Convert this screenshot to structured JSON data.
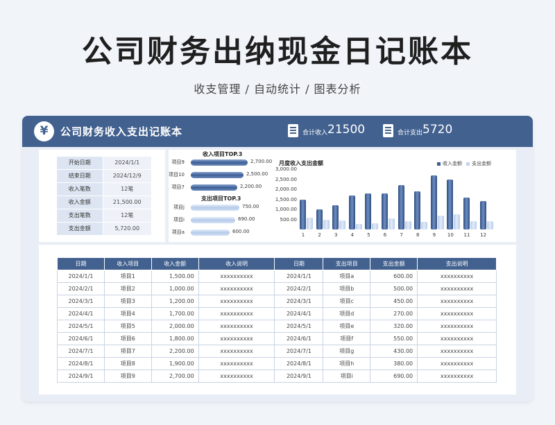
{
  "page": {
    "title": "公司财务出纳现金日记账本",
    "subtitle": "收支管理 / 自动统计 / 图表分析"
  },
  "header": {
    "icon": "yen-icon",
    "icon_glyph": "¥",
    "title": "公司财务收入支出记账本",
    "total_income_label": "合计收入",
    "total_income_value": "21500",
    "total_expense_label": "合计支出",
    "total_expense_value": "5720"
  },
  "summary": [
    {
      "label": "开始日期",
      "value": "2024/1/1"
    },
    {
      "label": "结束日期",
      "value": "2024/12/9"
    },
    {
      "label": "收入笔数",
      "value": "12笔"
    },
    {
      "label": "收入金额",
      "value": "21,500.00"
    },
    {
      "label": "支出笔数",
      "value": "12笔"
    },
    {
      "label": "支出金额",
      "value": "5,720.00"
    }
  ],
  "top3": {
    "income_title": "收入项目TOP.3",
    "income": [
      {
        "name": "项目9",
        "value": 2700,
        "label": "2,700.00"
      },
      {
        "name": "项目10",
        "value": 2500,
        "label": "2,500.00"
      },
      {
        "name": "项目7",
        "value": 2200,
        "label": "2,200.00"
      }
    ],
    "expense_title": "支出项目TOP.3",
    "expense": [
      {
        "name": "项目j",
        "value": 750,
        "label": "750.00"
      },
      {
        "name": "项目i",
        "value": 690,
        "label": "690.00"
      },
      {
        "name": "项目a",
        "value": 600,
        "label": "600.00"
      }
    ]
  },
  "chart_data": {
    "type": "bar",
    "title": "月度收入支出金额",
    "categories": [
      "1",
      "2",
      "3",
      "4",
      "5",
      "6",
      "7",
      "8",
      "9",
      "10",
      "11",
      "12"
    ],
    "series": [
      {
        "name": "收入金额",
        "values": [
          1500,
          1000,
          1200,
          1700,
          1800,
          1800,
          2200,
          1900,
          2700,
          2500,
          1600,
          1400
        ]
      },
      {
        "name": "支出金额",
        "values": [
          600,
          500,
          450,
          270,
          320,
          550,
          430,
          380,
          690,
          750,
          400,
          430
        ]
      }
    ],
    "yticks": [
      "500.00",
      "1,000.00",
      "1,500.00",
      "2,000.00",
      "2,500.00",
      "3,000.00"
    ],
    "ylim": [
      0,
      3000
    ],
    "legend": "top-right",
    "colors": {
      "income": "#3d5e95",
      "expense": "#c3d4ee"
    }
  },
  "table": {
    "columns": [
      "日期",
      "收入项目",
      "收入金额",
      "收入说明",
      "日期",
      "支出项目",
      "支出金额",
      "支出说明"
    ],
    "rows": [
      [
        "2024/1/1",
        "项目1",
        "1,500.00",
        "xxxxxxxxxx",
        "2024/1/1",
        "项目a",
        "600.00",
        "xxxxxxxxxx"
      ],
      [
        "2024/2/1",
        "项目2",
        "1,000.00",
        "xxxxxxxxxx",
        "2024/2/1",
        "项目b",
        "500.00",
        "xxxxxxxxxx"
      ],
      [
        "2024/3/1",
        "项目3",
        "1,200.00",
        "xxxxxxxxxx",
        "2024/3/1",
        "项目c",
        "450.00",
        "xxxxxxxxxx"
      ],
      [
        "2024/4/1",
        "项目4",
        "1,700.00",
        "xxxxxxxxxx",
        "2024/4/1",
        "项目d",
        "270.00",
        "xxxxxxxxxx"
      ],
      [
        "2024/5/1",
        "项目5",
        "2,000.00",
        "xxxxxxxxxx",
        "2024/5/1",
        "项目e",
        "320.00",
        "xxxxxxxxxx"
      ],
      [
        "2024/6/1",
        "项目6",
        "1,800.00",
        "xxxxxxxxxx",
        "2024/6/1",
        "项目f",
        "550.00",
        "xxxxxxxxxx"
      ],
      [
        "2024/7/1",
        "项目7",
        "2,200.00",
        "xxxxxxxxxx",
        "2024/7/1",
        "项目g",
        "430.00",
        "xxxxxxxxxx"
      ],
      [
        "2024/8/1",
        "项目8",
        "1,900.00",
        "xxxxxxxxxx",
        "2024/8/1",
        "项目h",
        "380.00",
        "xxxxxxxxxx"
      ],
      [
        "2024/9/1",
        "项目9",
        "2,700.00",
        "xxxxxxxxxx",
        "2024/9/1",
        "项目i",
        "690.00",
        "xxxxxxxxxx"
      ]
    ]
  }
}
